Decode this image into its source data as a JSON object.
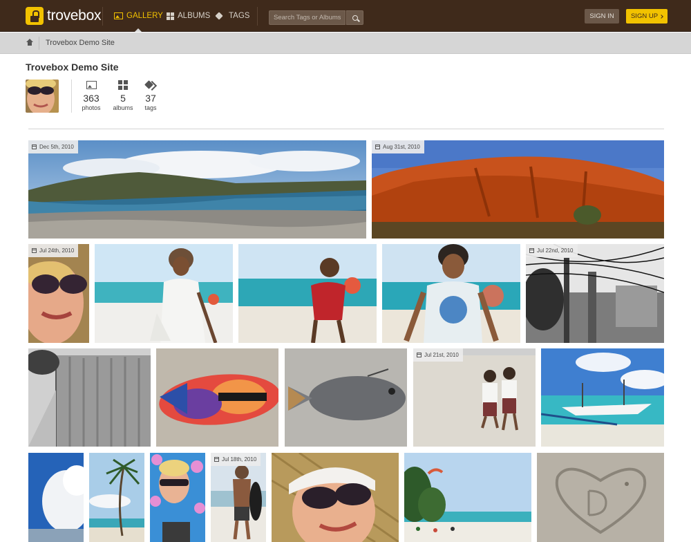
{
  "header": {
    "logo_text": "trovebox",
    "nav": [
      {
        "label": "Gallery",
        "icon": "picture-icon",
        "active": true
      },
      {
        "label": "Albums",
        "icon": "grid-icon",
        "active": false
      },
      {
        "label": "Tags",
        "icon": "tag-icon",
        "active": false
      }
    ],
    "search_placeholder": "Search Tags or Albums...",
    "sign_in_label": "Sign in",
    "sign_up_label": "Sign up"
  },
  "breadcrumb": {
    "home_icon": "home-icon",
    "current": "Trovebox Demo Site"
  },
  "profile": {
    "title": "Trovebox Demo Site",
    "stats": [
      {
        "value": "363",
        "label": "photos",
        "icon": "picture-icon"
      },
      {
        "value": "5",
        "label": "albums",
        "icon": "grid-icon"
      },
      {
        "value": "37",
        "label": "tags",
        "icon": "tags-icon"
      }
    ]
  },
  "gallery": {
    "dates": {
      "photo1": "Dec 5th, 2010",
      "photo2": "Aug 31st, 2010",
      "photo3": "Jul 24th, 2010",
      "photo7": "Jul 22nd, 2010",
      "photo11": "Jul 21st, 2010",
      "photo16": "Jul 18th, 2010"
    }
  },
  "colors": {
    "header_bg": "#3f2a1b",
    "accent": "#f2c200",
    "breadcrumb_bg": "#d6d6d6"
  }
}
